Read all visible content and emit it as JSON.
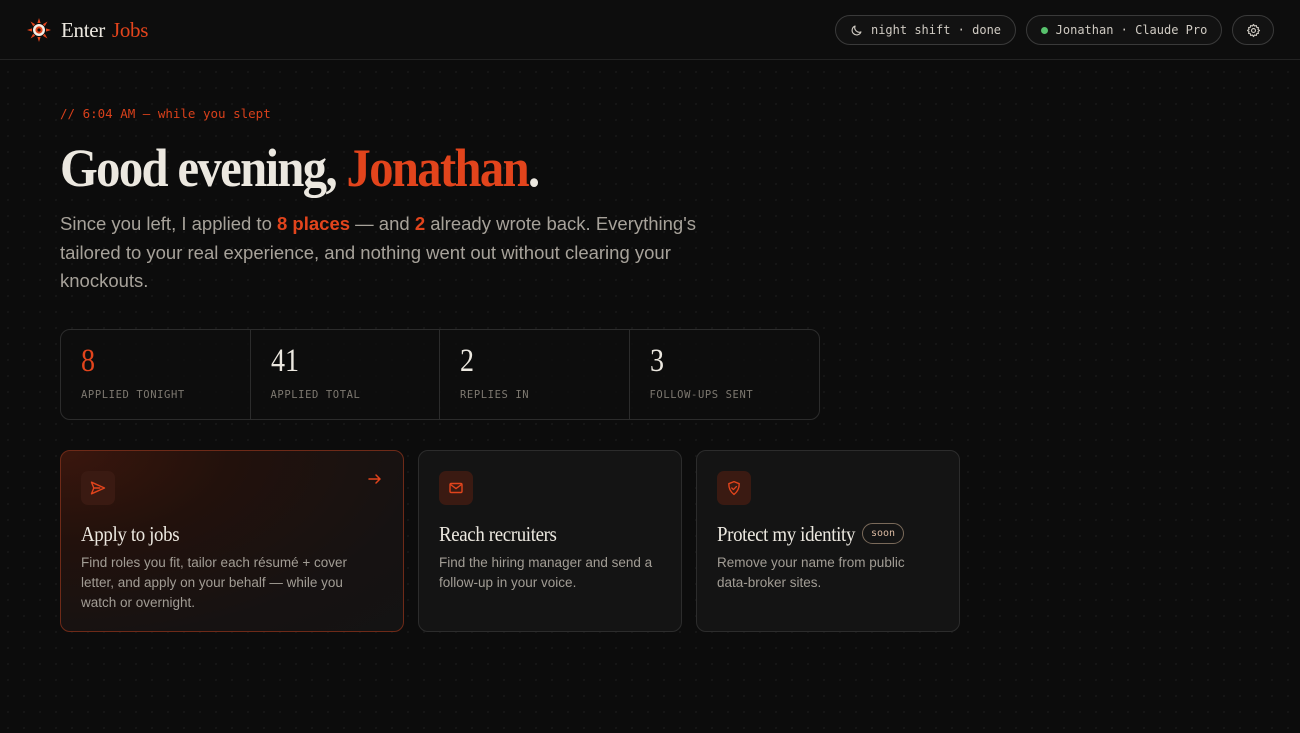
{
  "header": {
    "brand": {
      "enter": "Enter",
      "jobs": "Jobs"
    },
    "night_pill": "night shift · done",
    "user_pill": "Jonathan · Claude Pro"
  },
  "hero": {
    "timestamp": "// 6:04 AM — while you slept",
    "greeting_prefix": "Good evening, ",
    "greeting_name": "Jonathan",
    "greeting_suffix": ".",
    "subtitle": {
      "part1": "Since you left, I applied to ",
      "applied": "8 places",
      "part2": " — and ",
      "replied": "2",
      "part3": " already wrote back. Everything's tailored to your real experience, and nothing went out without clearing your knockouts."
    }
  },
  "stats": [
    {
      "value": "8",
      "label": "APPLIED TONIGHT"
    },
    {
      "value": "41",
      "label": "APPLIED TOTAL"
    },
    {
      "value": "2",
      "label": "REPLIES IN"
    },
    {
      "value": "3",
      "label": "FOLLOW-UPS SENT"
    }
  ],
  "cards": {
    "apply": {
      "title": "Apply to jobs",
      "desc": "Find roles you fit, tailor each résumé + cover letter, and apply on your behalf — while you watch or overnight.",
      "icon": "send-icon"
    },
    "recruiters": {
      "title": "Reach recruiters",
      "desc": "Find the hiring manager and send a follow-up in your voice.",
      "icon": "mail-icon"
    },
    "identity": {
      "title": "Protect my identity",
      "badge": "soon",
      "desc": "Remove your name from public data-broker sites.",
      "icon": "shield-icon"
    }
  },
  "colors": {
    "accent": "#e2441c",
    "background": "#0c0c0c",
    "online": "#58c26d"
  }
}
